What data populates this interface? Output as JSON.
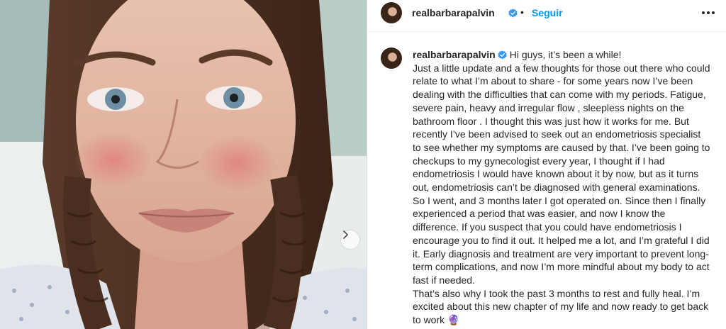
{
  "post": {
    "username": "realbarbarapalvin",
    "follow_label": "Seguir",
    "separator": "•",
    "caption_lines": [
      "Hi guys, it’s been a while!",
      "Just a little update and a few thoughts for those out there who could relate to what I’m about to share - for some years now I’ve been dealing with the difficulties that can come with my periods. Fatigue, severe pain, heavy and irregular flow , sleepless nights on the bathroom floor . I thought this was just how it works for me. But recently I’ve been advised to seek out an endometriosis specialist to see whether my symptoms are caused by that. I’ve been going to checkups to my gynecologist every year, I thought if I had endometriosis I would have known about it by now, but as it turns out, endometriosis can’t be diagnosed with general examinations. So I went, and 3 months later I got operated on. Since then I finally experienced a period that was easier, and now I know the difference. If you suspect that you could have endometriosis I encourage you to find it out. It helped me a lot, and I’m grateful I did it. Early diagnosis and treatment are very important to prevent long-term complications, and now I’m more mindful about my body to act fast if needed.",
      "That’s also why I took the past 3 months to rest and fully heal. I’m excited about this new chapter of my life and now ready to get back to work 🔮"
    ]
  },
  "icons": {
    "verified": "verified-badge-icon",
    "more": "more-options-icon",
    "next": "chevron-right-icon"
  },
  "colors": {
    "accent": "#0095f6",
    "text": "#262626",
    "verified": "#3897f0"
  }
}
